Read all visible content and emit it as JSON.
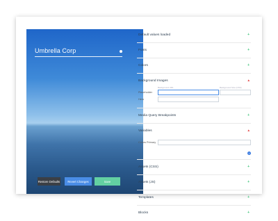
{
  "preview": {
    "brand_name": "Umbrella Corp",
    "buttons": {
      "restore": "Restore Defaults",
      "revert": "Revert Changes",
      "save": "Save"
    }
  },
  "panel": {
    "sections": {
      "defaults": "Default values loaded",
      "fonts": "Fonts",
      "colors": "Colors",
      "background_images": "Background Images",
      "media_query": "Media Query Breakpoints",
      "variables": "Variables",
      "assets_css": "Assets (CSS)",
      "assets_js": "Assets (JS)",
      "templates": "Templates",
      "blocks": "Blocks"
    },
    "background_images": {
      "placeholder_label": "Placeholder",
      "hero_label": "Hero",
      "hint_left": "Background URL",
      "hint_right": "Background Size (CSS)"
    },
    "variables": {
      "color_primary_label": "Colors Primary"
    },
    "toggle_closed": "+",
    "toggle_open": "▴"
  },
  "colors": {
    "accent_blue": "#4a8de6",
    "accent_green": "#63d0a2",
    "toggle_red": "#e34b4b"
  }
}
